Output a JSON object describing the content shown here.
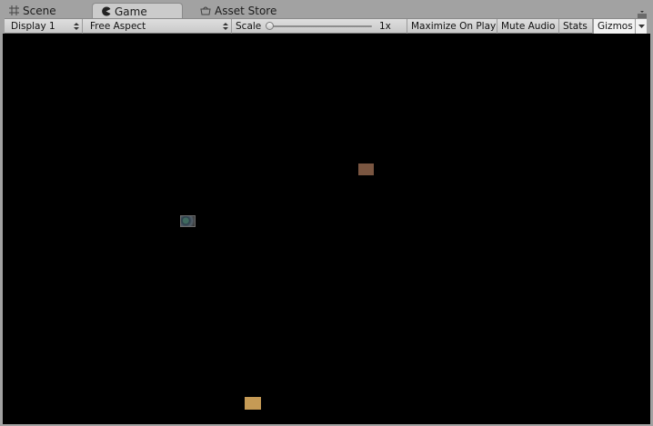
{
  "tabs": [
    {
      "label": "Scene",
      "icon": "grid-icon"
    },
    {
      "label": "Game",
      "icon": "pacman-icon",
      "active": true
    },
    {
      "label": "Asset Store",
      "icon": "store-icon"
    }
  ],
  "toolbar": {
    "display": "Display 1",
    "aspect": "Free Aspect",
    "scale_label": "Scale",
    "scale_value": "1x",
    "scale_level": 0.0,
    "maximize": "Maximize On Play",
    "mute": "Mute Audio",
    "stats": "Stats",
    "gizmos": "Gizmos"
  },
  "colors": {
    "viewport_bg": "#000000",
    "sprite_brown": "#7a5641",
    "sprite_gold": "#c59a55"
  }
}
